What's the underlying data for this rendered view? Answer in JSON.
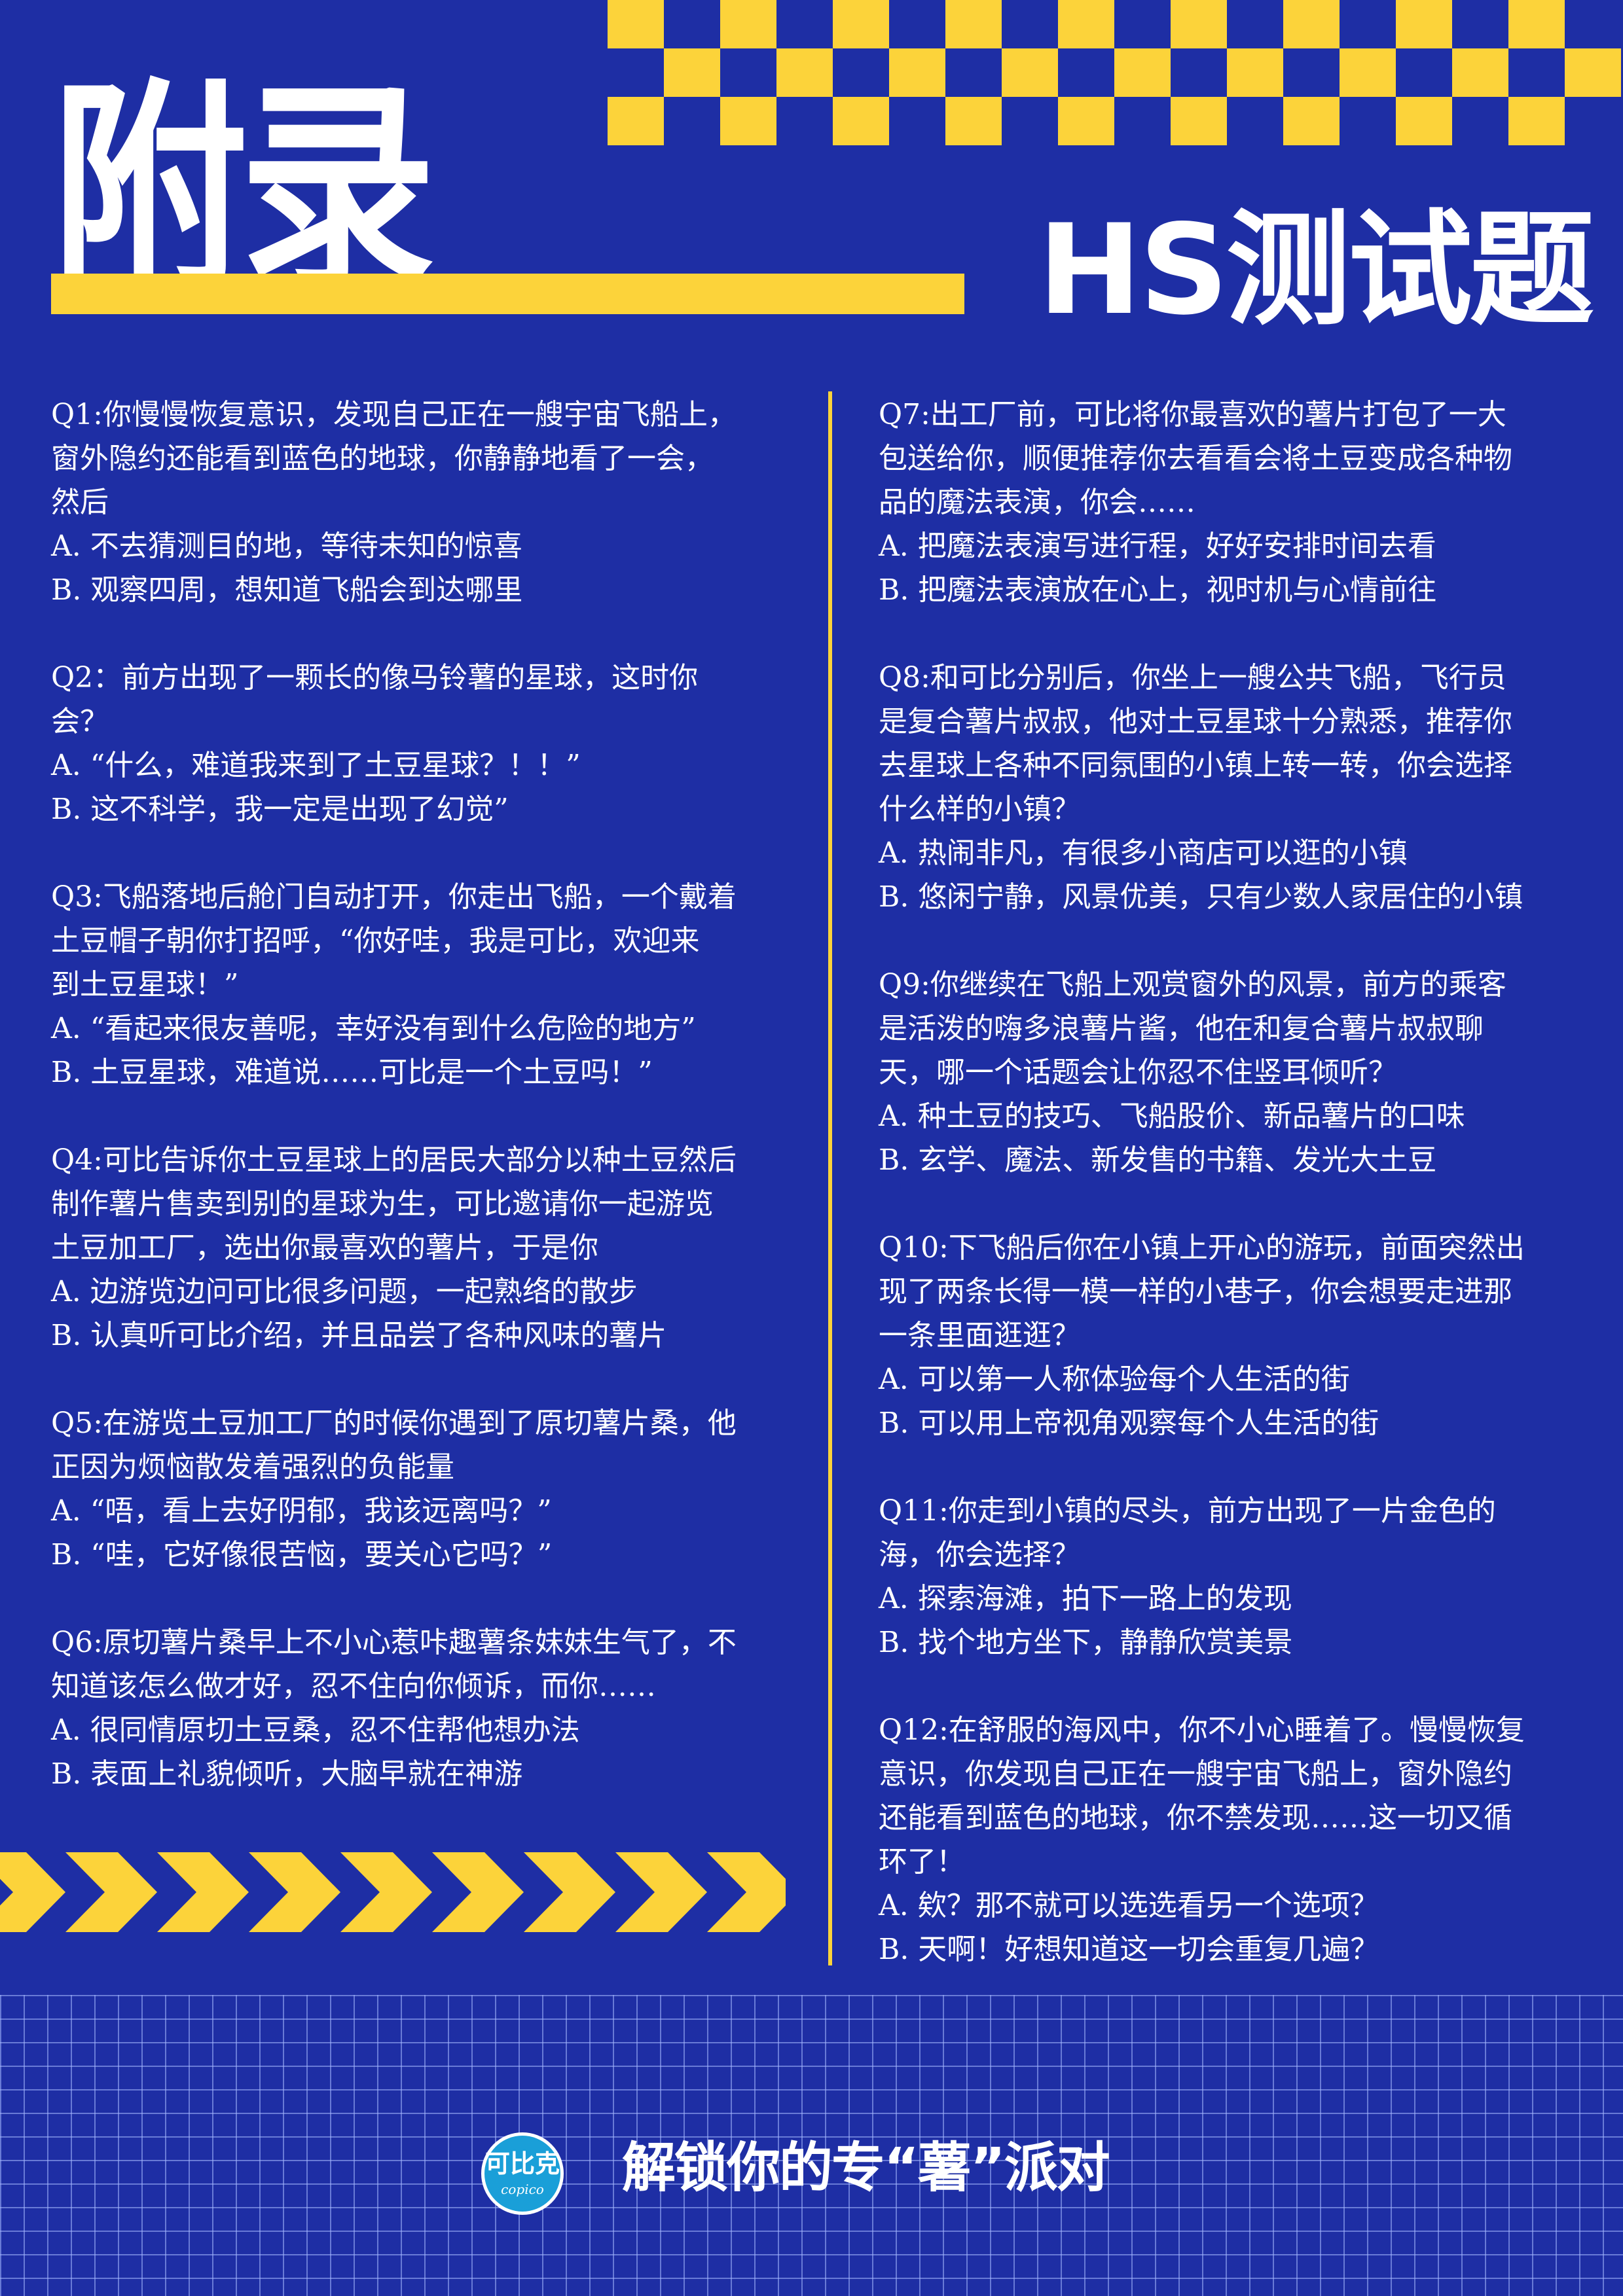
{
  "header": {
    "title": "附录",
    "subtitle": "HS测试题"
  },
  "colors": {
    "background": "#1e2ea4",
    "accent": "#fcd33a",
    "text": "#ffffff",
    "logo_blue": "#1a9fd8"
  },
  "left_column": [
    {
      "lines": [
        "Q1:你慢慢恢复意识，发现自己正在一艘宇宙飞船上，",
        "窗外隐约还能看到蓝色的地球，你静静地看了一会，",
        "然后",
        "A. 不去猜测目的地，等待未知的惊喜",
        "B. 观察四周，想知道飞船会到达哪里"
      ]
    },
    {
      "lines": [
        "Q2：前方出现了一颗长的像马铃薯的星球，这时你",
        "会？",
        "A. “什么，难道我来到了土豆星球？！！”",
        "B. 这不科学，我一定是出现了幻觉”"
      ]
    },
    {
      "lines": [
        "Q3:飞船落地后舱门自动打开，你走出飞船，一个戴着",
        "土豆帽子朝你打招呼，“你好哇，我是可比，欢迎来",
        "到土豆星球！”",
        "A. “看起来很友善呢，幸好没有到什么危险的地方”",
        "B. 土豆星球，难道说……可比是一个土豆吗！”"
      ]
    },
    {
      "lines": [
        "Q4:可比告诉你土豆星球上的居民大部分以种土豆然后",
        "制作薯片售卖到别的星球为生，可比邀请你一起游览",
        "土豆加工厂，选出你最喜欢的薯片，于是你",
        "A. 边游览边问可比很多问题，一起熟络的散步",
        "B. 认真听可比介绍，并且品尝了各种风味的薯片"
      ]
    },
    {
      "lines": [
        "Q5:在游览土豆加工厂的时候你遇到了原切薯片桑，他",
        "正因为烦恼散发着强烈的负能量",
        "A. “唔，看上去好阴郁，我该远离吗？”",
        "B. “哇，它好像很苦恼，要关心它吗？”"
      ]
    },
    {
      "lines": [
        "Q6:原切薯片桑早上不小心惹咔趣薯条妹妹生气了，不",
        "知道该怎么做才好，忍不住向你倾诉，而你……",
        "A. 很同情原切土豆桑，忍不住帮他想办法",
        "B. 表面上礼貌倾听，大脑早就在神游"
      ]
    }
  ],
  "right_column": [
    {
      "lines": [
        "Q7:出工厂前，可比将你最喜欢的薯片打包了一大",
        "包送给你，顺便推荐你去看看会将土豆变成各种物",
        "品的魔法表演，你会……",
        "A. 把魔法表演写进行程，好好安排时间去看",
        "B. 把魔法表演放在心上，视时机与心情前往"
      ]
    },
    {
      "lines": [
        "Q8:和可比分别后，你坐上一艘公共飞船，飞行员",
        "是复合薯片叔叔，他对土豆星球十分熟悉，推荐你",
        "去星球上各种不同氛围的小镇上转一转，你会选择",
        "什么样的小镇？",
        "A. 热闹非凡，有很多小商店可以逛的小镇",
        "B. 悠闲宁静，风景优美，只有少数人家居住的小镇"
      ]
    },
    {
      "lines": [
        "Q9:你继续在飞船上观赏窗外的风景，前方的乘客",
        "是活泼的嗨多浪薯片酱，他在和复合薯片叔叔聊",
        "天，哪一个话题会让你忍不住竖耳倾听？",
        "A. 种土豆的技巧、飞船股价、新品薯片的口味",
        "B. 玄学、魔法、新发售的书籍、发光大土豆"
      ]
    },
    {
      "lines": [
        "Q10:下飞船后你在小镇上开心的游玩，前面突然出",
        "现了两条长得一模一样的小巷子，你会想要走进那",
        "一条里面逛逛？",
        "A. 可以第一人称体验每个人生活的街",
        "B. 可以用上帝视角观察每个人生活的街"
      ]
    },
    {
      "lines": [
        "Q11:你走到小镇的尽头，前方出现了一片金色的",
        "海，你会选择？",
        "A. 探索海滩，拍下一路上的发现",
        "B. 找个地方坐下，静静欣赏美景"
      ]
    },
    {
      "lines": [
        "Q12:在舒服的海风中，你不小心睡着了。慢慢恢复",
        "意识，你发现自己正在一艘宇宙飞船上，窗外隐约",
        "还能看到蓝色的地球，你不禁发现……这一切又循",
        "环了！",
        "A. 欸？那不就可以选选看另一个选项？",
        "B. 天啊！好想知道这一切会重复几遍？"
      ]
    }
  ],
  "footer": {
    "logo_cn": "可比克",
    "logo_en": "copico",
    "slogan": "解锁你的专“薯”派对"
  }
}
